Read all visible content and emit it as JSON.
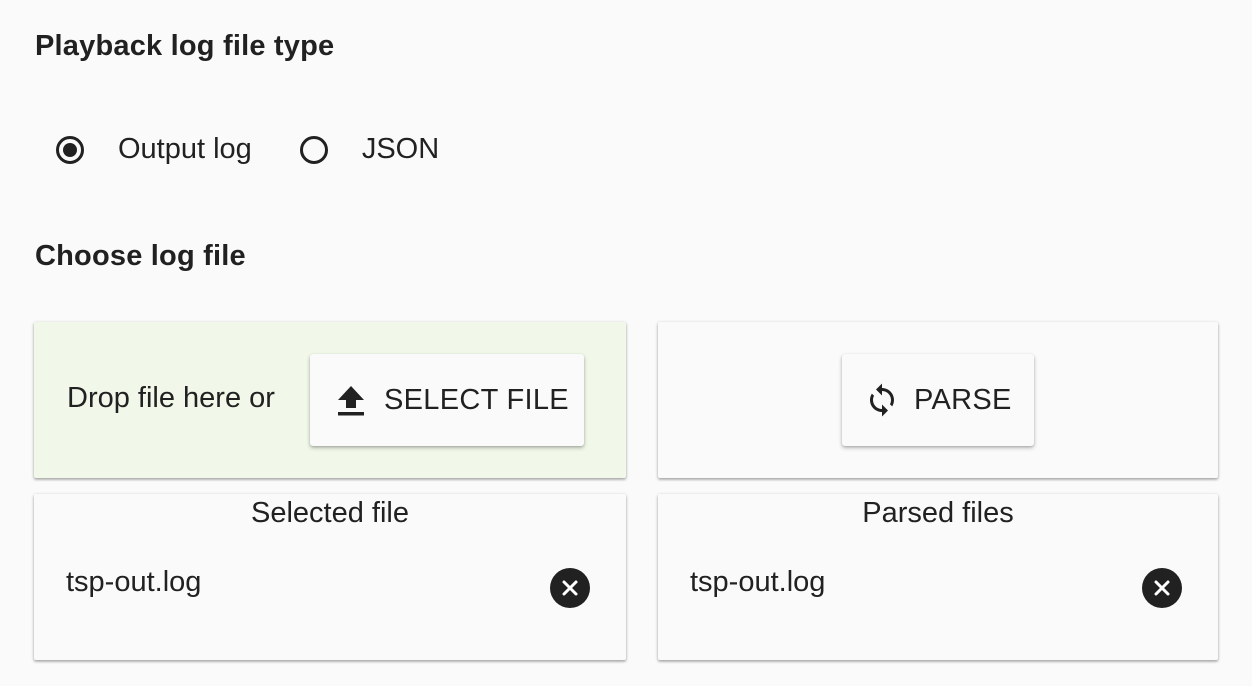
{
  "playback_type": {
    "title": "Playback log file type",
    "options": [
      {
        "label": "Output log",
        "selected": true
      },
      {
        "label": "JSON",
        "selected": false
      }
    ]
  },
  "choose": {
    "title": "Choose log file",
    "drop_text": "Drop file here or",
    "select_button": {
      "label": "SELECT FILE",
      "icon": "upload-icon"
    },
    "parse_button": {
      "label": "PARSE",
      "icon": "refresh-icon"
    },
    "drop_zone_color": "#f1f8e9"
  },
  "selected": {
    "header": "Selected file",
    "files": [
      "tsp-out.log"
    ]
  },
  "parsed": {
    "header": "Parsed files",
    "files": [
      "tsp-out.log"
    ]
  }
}
